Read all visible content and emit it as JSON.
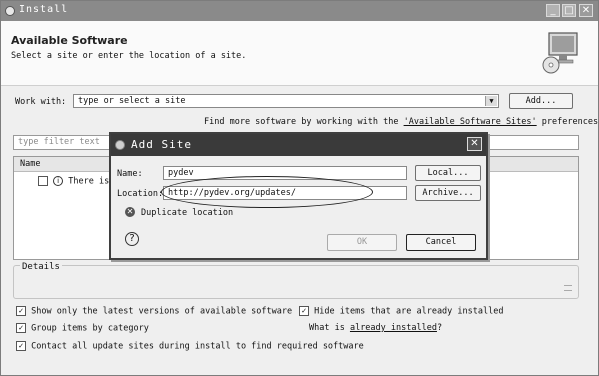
{
  "window": {
    "title": "Install",
    "header_title": "Available Software",
    "header_subtitle": "Select a site or enter the location of a site."
  },
  "work_with": {
    "label": "Work with:",
    "value": "type or select a site",
    "add_label": "Add...",
    "find_prefix": "Find more software by working with the",
    "find_link": "'Available Software Sites'",
    "find_suffix": "preferences."
  },
  "filter": {
    "placeholder": "type filter text"
  },
  "tree": {
    "column_name": "Name",
    "row_text": "There is n"
  },
  "details": {
    "label": "Details"
  },
  "options": {
    "latest": "Show only the latest versions of available software",
    "hide": "Hide items that are already installed",
    "group": "Group items by category",
    "installed_prefix": "What is",
    "installed_link": "already installed",
    "installed_suffix": "?",
    "contact": "Contact all update sites during install to find required software"
  },
  "dialog": {
    "title": "Add Site",
    "name_label": "Name:",
    "name_value": "pydev",
    "location_label": "Location:",
    "location_value": "http://pydev.org/updates/",
    "local_label": "Local...",
    "archive_label": "Archive...",
    "error_text": "Duplicate location",
    "ok_label": "OK",
    "cancel_label": "Cancel"
  }
}
